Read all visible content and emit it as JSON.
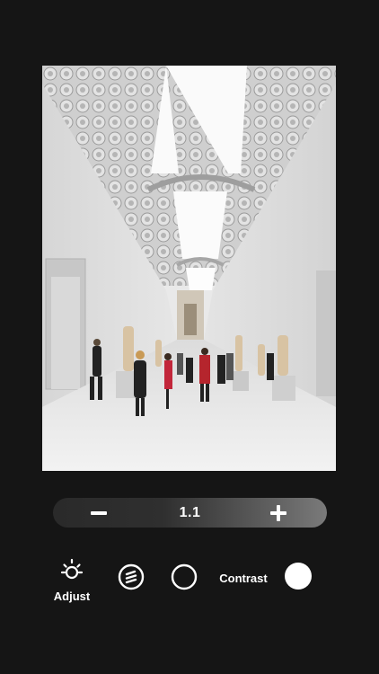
{
  "photo": {
    "subject": "museum sculpture hall"
  },
  "stepper": {
    "value": "1.1",
    "minus_icon": "minus-icon",
    "plus_icon": "plus-icon"
  },
  "toolbar": {
    "adjust_label": "Adjust",
    "adjust_icon": "sun-icon",
    "lines_icon": "circle-lines-icon",
    "circle_icon": "circle-outline-icon",
    "contrast_label": "Contrast",
    "fill_icon": "filled-circle-icon"
  }
}
